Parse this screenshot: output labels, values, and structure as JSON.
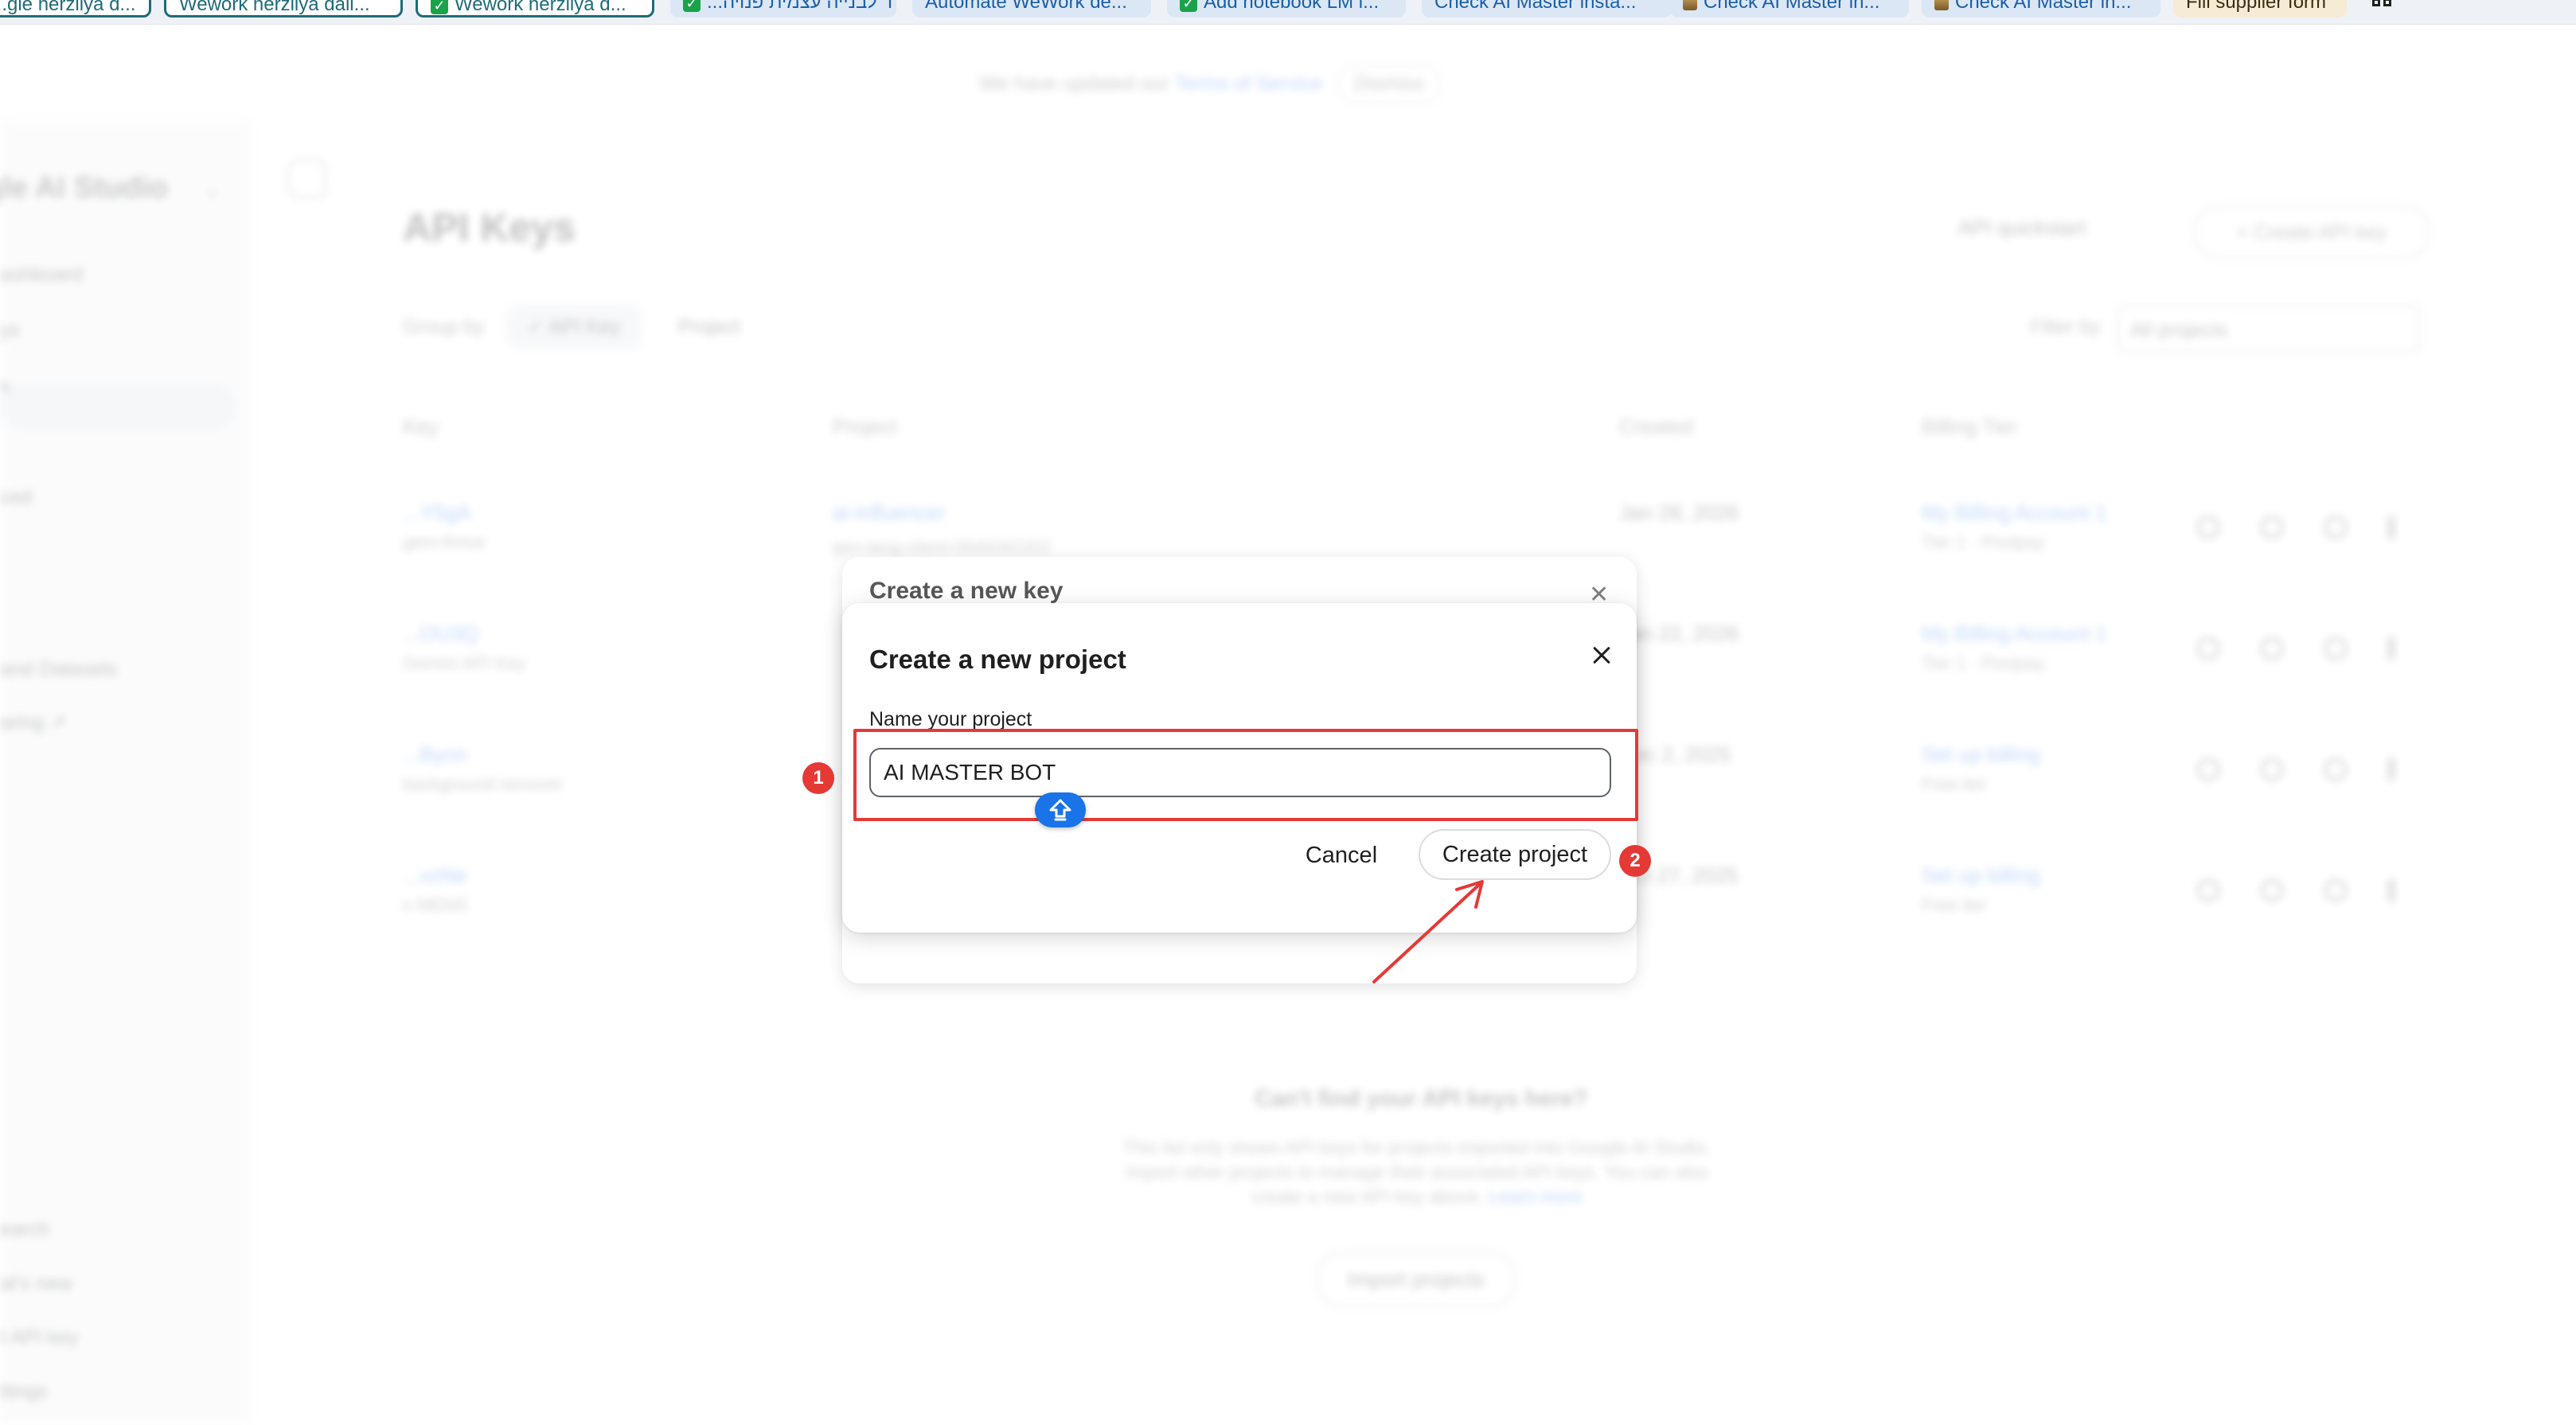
{
  "bookmarks": [
    {
      "label": "...gle herzliya d...",
      "style": "outlined"
    },
    {
      "label": "Wework herzliya dail...",
      "style": "outlined"
    },
    {
      "label": "Wework herzliya d...",
      "style": "outlined",
      "icon": "check-icon"
    },
    {
      "label": "...ומשרד לבנייה עצמית פנויה",
      "style": "soft",
      "icon": "check-icon"
    },
    {
      "label": "Automate WeWork de...",
      "style": "soft"
    },
    {
      "label": "Add notebook LM i...",
      "style": "soft",
      "icon": "check-icon"
    },
    {
      "label": "Check AI Master insta...",
      "style": "soft"
    },
    {
      "label": "Check AI Master in...",
      "style": "soft",
      "icon": "image-icon"
    },
    {
      "label": "Check AI Master in...",
      "style": "soft",
      "icon": "image-icon"
    },
    {
      "label": "Fill supplier form",
      "style": "warm"
    }
  ],
  "notice": {
    "text": "We have updated our ",
    "link": "Terms of Service",
    "dismiss": "Dismiss"
  },
  "sidebar": {
    "title": "gle AI Studio",
    "items": [
      "ashboard",
      "ys",
      "s",
      "",
      "ced",
      "",
      "and Datasets",
      "aring ↗"
    ],
    "bottom": [
      "earch",
      "at's new",
      "t API key",
      "ttings"
    ]
  },
  "page": {
    "title": "API Keys",
    "quickstart": "API quickstart",
    "create_key": "+ Create API key",
    "group_by": "Group by",
    "group_api_key": "✓ API Key",
    "group_project": "Project",
    "filter_by": "Filter by",
    "filter_value": "All projects",
    "columns": [
      "Key",
      "Project",
      "Created",
      "Billing Tier"
    ],
    "rows": [
      {
        "key": "...Y5gA",
        "key_sub": "gem-thrive",
        "project": "ai-influencer",
        "project_sub": "gen-lang-client-0949262202",
        "created": "Jan 28, 2026",
        "billing": "My Billing Account 1",
        "billing_sub": "Tier 1 · Postpay"
      },
      {
        "key": "...OU3Q",
        "key_sub": "Gemini API Key",
        "project": "",
        "project_sub": "",
        "created": "Jan 22, 2026",
        "billing": "My Billing Account 1",
        "billing_sub": "Tier 1 · Postpay"
      },
      {
        "key": "...Bynn",
        "key_sub": "background remover",
        "project": "",
        "project_sub": "",
        "created": "Dec 2, 2025",
        "billing": "Set up billing",
        "billing_sub": "Free tier"
      },
      {
        "key": "...vzNe",
        "key_sub": "n MENS",
        "project": "",
        "project_sub": "",
        "created": "Oct 27, 2025",
        "billing": "Set up billing",
        "billing_sub": "Free tier"
      }
    ],
    "empty_title": "Can't find your API keys here?",
    "empty_text": "This list only shows API keys for projects imported into Google AI Studio. Import other projects to manage their associated API keys. You can also create a new API key above.",
    "empty_link": "Learn more",
    "import_button": "Import projects"
  },
  "key_dialog": {
    "title": "Create a new key"
  },
  "dialog": {
    "title": "Create a new project",
    "field_label": "Name your project",
    "field_value": "AI MASTER BOT",
    "cancel": "Cancel",
    "create": "Create project"
  },
  "annotations": {
    "step1": "1",
    "step2": "2",
    "color": "#e53935"
  }
}
